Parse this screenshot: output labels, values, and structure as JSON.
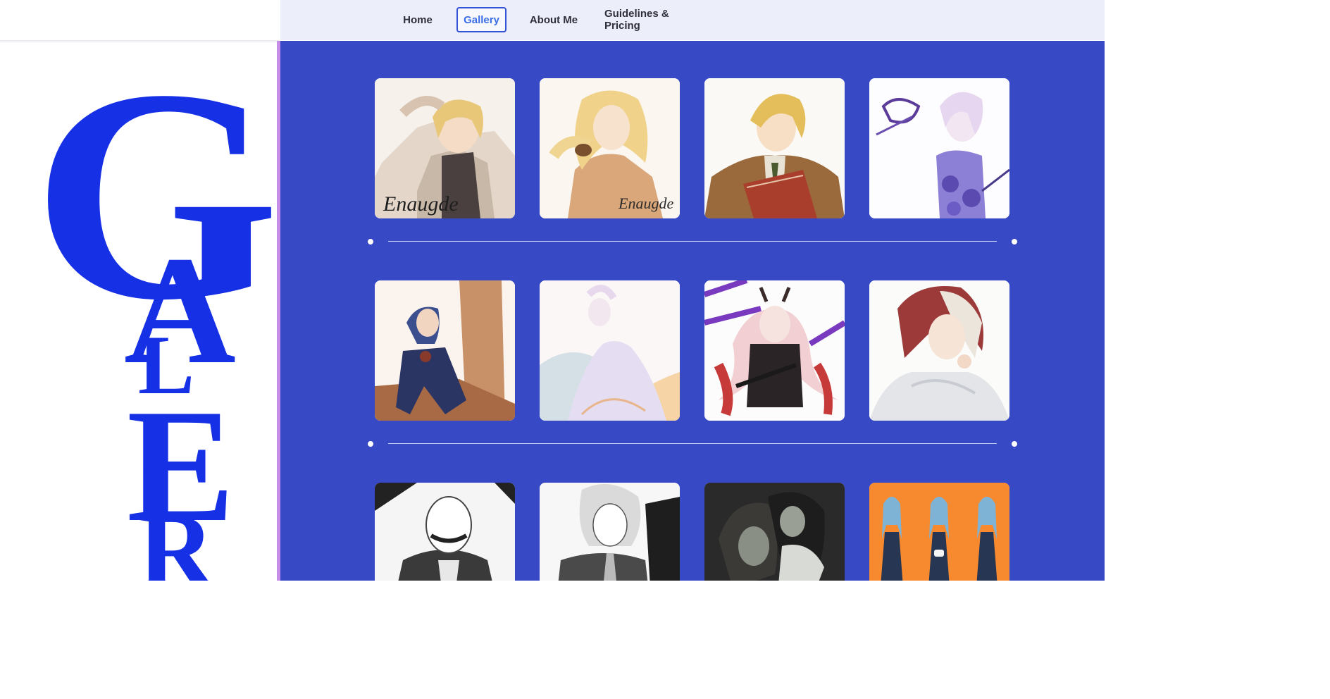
{
  "nav": {
    "items": [
      {
        "label": "Home"
      },
      {
        "label": "Gallery",
        "active": true
      },
      {
        "label": "About Me"
      },
      {
        "label": "Guidelines & Pricing"
      }
    ]
  },
  "hero": {
    "letters": [
      "G",
      "A",
      "L",
      "E",
      "R"
    ]
  },
  "gallery": {
    "signature": "Enaugde",
    "artworks": [
      {
        "name": "blonde-boy-hand-on-head"
      },
      {
        "name": "blonde-girl-with-bird"
      },
      {
        "name": "blonde-boy-reading-book"
      },
      {
        "name": "lavender-girl-with-roses"
      },
      {
        "name": "blue-hair-boy-sitting"
      },
      {
        "name": "pastel-girl-in-gown"
      },
      {
        "name": "pink-hair-girl-with-horns"
      },
      {
        "name": "red-white-hair-girl"
      },
      {
        "name": "monochrome-mustache-man"
      },
      {
        "name": "monochrome-silver-hair-man"
      },
      {
        "name": "dark-couple-embrace"
      },
      {
        "name": "character-turnaround-blue-dress"
      }
    ]
  },
  "colors": {
    "accent_blue": "#3849c5",
    "hero_letter": "#1630e6",
    "nav_background": "#eceefa",
    "side_strip": "#c48ee8",
    "active_nav": "#3b6ee6"
  }
}
